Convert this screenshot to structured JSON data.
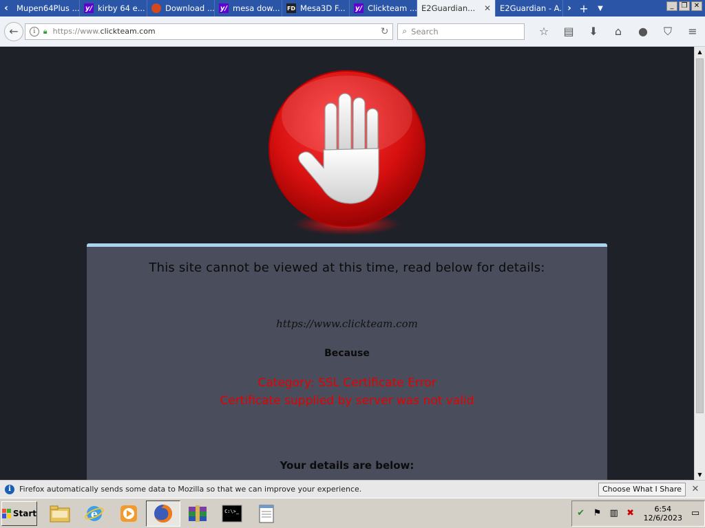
{
  "tabs": [
    {
      "label": "Mupen64Plus ...",
      "favicon": "none-icon",
      "active": false
    },
    {
      "label": "kirby 64 e...",
      "favicon": "yahoo-icon",
      "active": false
    },
    {
      "label": "Download ...",
      "favicon": "orange-circle-icon",
      "active": false
    },
    {
      "label": "mesa dow...",
      "favicon": "yahoo-icon",
      "active": false
    },
    {
      "label": "Mesa3D F...",
      "favicon": "fd-icon",
      "active": false
    },
    {
      "label": "Clickteam ...",
      "favicon": "yahoo-icon",
      "active": false
    },
    {
      "label": "E2Guardian...",
      "favicon": "none-icon",
      "active": true
    },
    {
      "label": "E2Guardian - A...",
      "favicon": "none-icon",
      "active": false
    }
  ],
  "fav_glyphs": {
    "yahoo": "y/",
    "fd": "FD"
  },
  "urlbar": {
    "url_prefix": "https://www.",
    "url_domain": "clickteam.com"
  },
  "searchbar": {
    "placeholder": "Search"
  },
  "page": {
    "title": "This site cannot be viewed at this time, read below for details:",
    "blocked_url": "https://www.clickteam.com",
    "because": "Because",
    "category": "Category: SSL Certificate Error",
    "reason": "Certificate supplied by server was not valid",
    "details_header": "Your details are below:"
  },
  "notification": {
    "text": "Firefox automatically sends some data to Mozilla so that we can improve your experience.",
    "button": "Choose What I Share"
  },
  "taskbar": {
    "start_label": "Start",
    "clock_time": "6:54",
    "clock_date": "12/6/2023"
  },
  "colors": {
    "accent_blue": "#2b56a8",
    "error_red": "#e60000",
    "card_bg": "#494d5c",
    "page_bg": "#1f2129",
    "card_border": "#a8d4f0"
  }
}
